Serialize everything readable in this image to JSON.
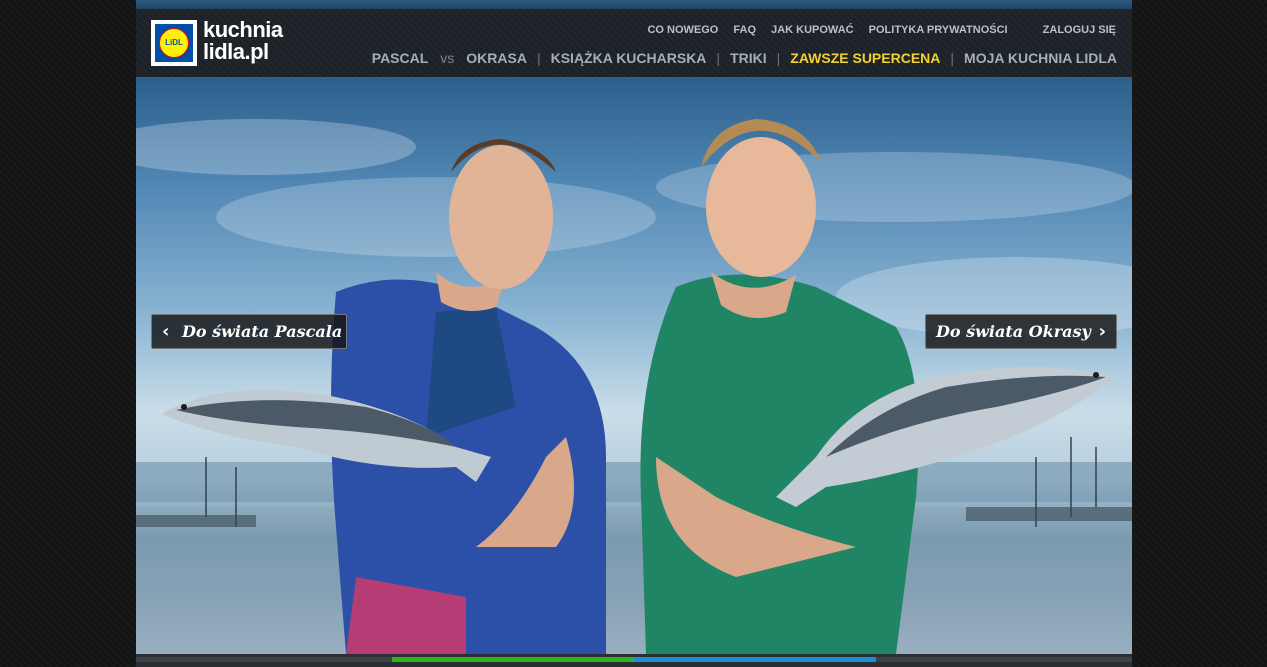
{
  "brand": {
    "logo_mark": "LiDL",
    "line1": "kuchnia",
    "line2": "lidla.pl"
  },
  "top_nav": {
    "items": [
      "CO NOWEGO",
      "FAQ",
      "JAK KUPOWAĆ",
      "POLITYKA PRYWATNOŚCI"
    ],
    "login": "ZALOGUJ SIĘ"
  },
  "main_nav": {
    "pascal": "PASCAL",
    "vs": "vs",
    "okrasa": "OKRASA",
    "cookbook": "KSIĄŻKA KUCHARSKA",
    "tricks": "TRIKI",
    "supercena": "ZAWSZE SUPERCENA",
    "my_kitchen": "MOJA KUCHNIA LIDLA"
  },
  "hero": {
    "left_button": "Do świata Pascala",
    "right_button": "Do świata Okrasy",
    "left_icon": "chevron-left-icon",
    "right_icon": "chevron-right-icon"
  },
  "colors": {
    "highlight": "#f2d230",
    "progress_green": "#2eb51e",
    "progress_blue": "#1a8fd8",
    "lidl_blue": "#0050aa",
    "lidl_yellow": "#fff100"
  }
}
